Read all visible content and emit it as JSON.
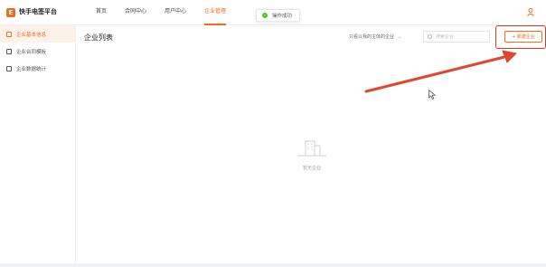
{
  "app": {
    "logo_letter": "E",
    "brand": "快手电签平台"
  },
  "nav": [
    {
      "label": "首页",
      "active": false
    },
    {
      "label": "合同中心",
      "active": false
    },
    {
      "label": "用户中心",
      "active": false
    },
    {
      "label": "企业管理",
      "active": true
    }
  ],
  "toast": {
    "text": "操作成功"
  },
  "sidebar": {
    "items": [
      {
        "label": "企业基本信息",
        "active": true
      },
      {
        "label": "企业合同模板",
        "active": false
      },
      {
        "label": "企业数据统计",
        "active": false
      }
    ]
  },
  "main": {
    "title": "企业列表",
    "filter_label": "只看以我的主体的企业",
    "search_placeholder": "搜索企业",
    "new_button": "+ 新建企业",
    "empty_text": "暂无企业"
  },
  "colors": {
    "accent": "#f36b21",
    "annotation": "#d9372b"
  }
}
